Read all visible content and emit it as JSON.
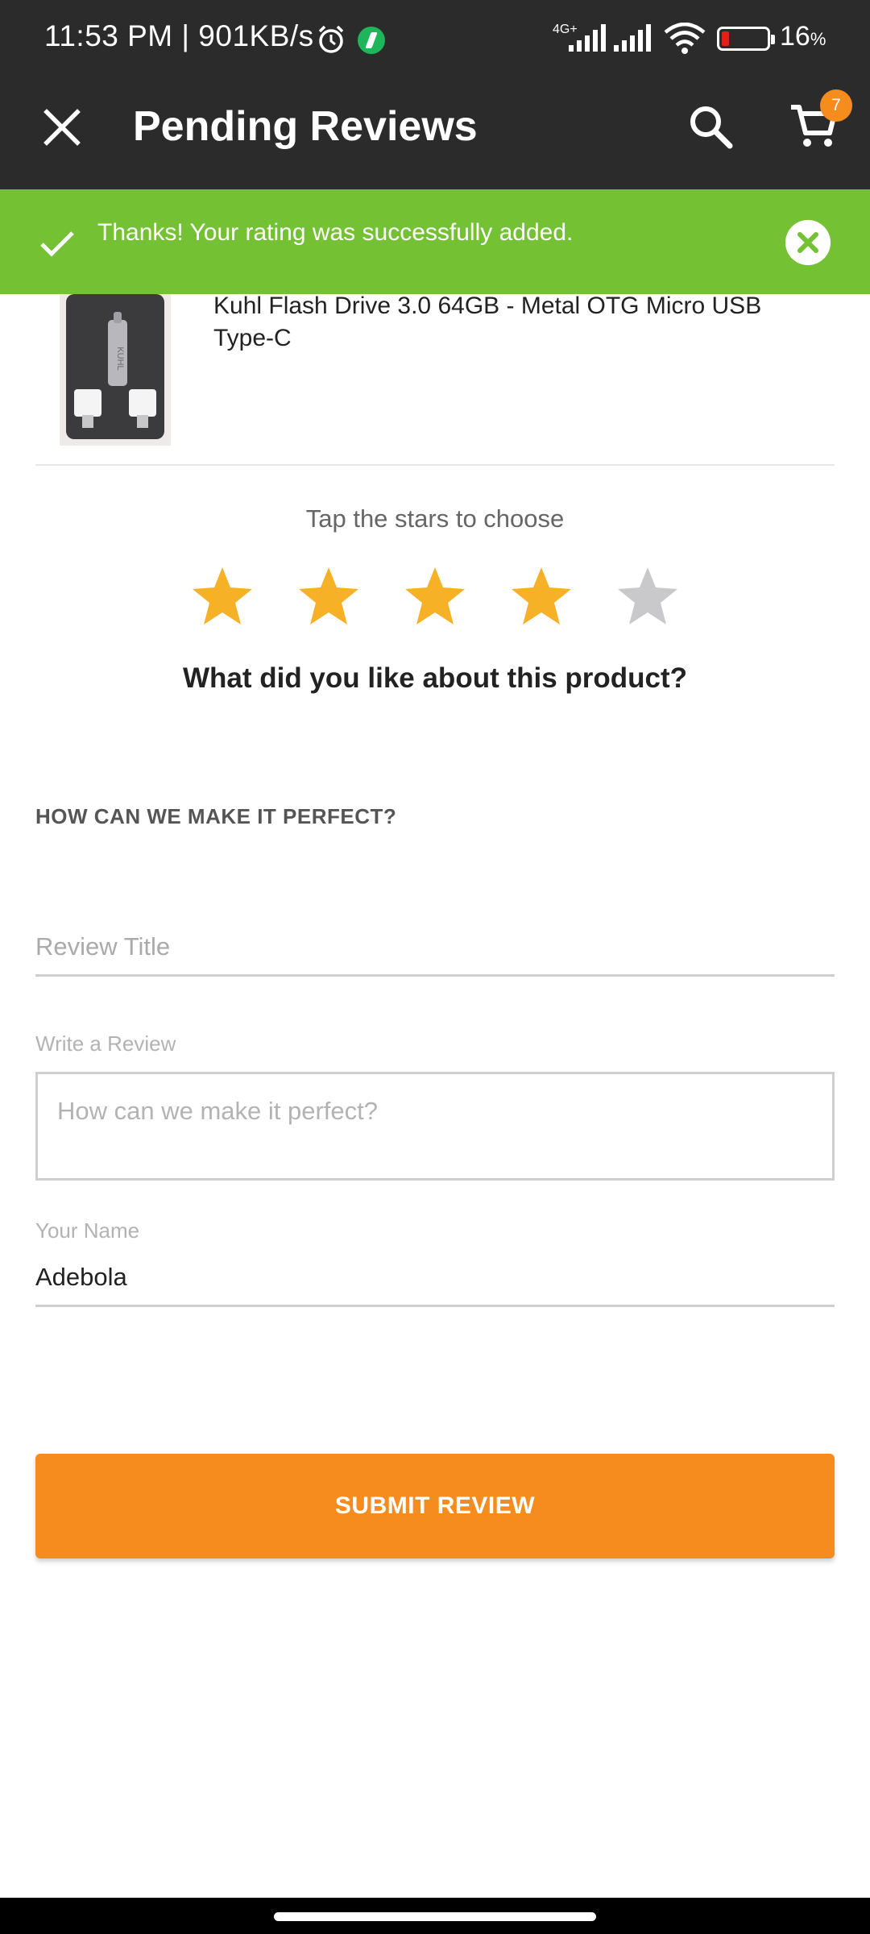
{
  "status_bar": {
    "time": "11:53 PM | 901KB/s",
    "network": "4G+",
    "battery": "16",
    "battery_unit": "%"
  },
  "app_bar": {
    "title": "Pending Reviews",
    "cart_count": "7",
    "icons": [
      "close-icon",
      "search-icon",
      "cart-icon"
    ]
  },
  "toast": {
    "message": "Thanks! Your rating was successfully added.",
    "color": "#75c134"
  },
  "product": {
    "title": "Kuhl Flash Drive 3.0 64GB - Metal OTG Micro USB Type-C",
    "image_label": "KUHL"
  },
  "rating": {
    "hint": "Tap the stars to choose",
    "value": 4,
    "max": 5,
    "filled_color": "#f6b126",
    "empty_color": "#c9c9cc"
  },
  "form": {
    "question": "What did you like about this product?",
    "perfect_label": "HOW CAN WE MAKE IT PERFECT?",
    "review_title_placeholder": "Review Title",
    "write_label": "Write a Review",
    "review_placeholder": "How can we make it perfect?",
    "name_label": "Your Name",
    "name_value": "Adebola",
    "submit_label": "SUBMIT REVIEW",
    "accent": "#f68b1e"
  }
}
